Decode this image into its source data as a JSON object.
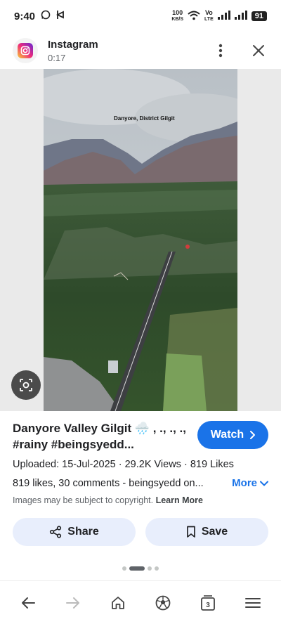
{
  "status_bar": {
    "time": "9:40",
    "net_speed_top": "100",
    "net_speed_bottom": "KB/S",
    "volte_top": "Vo",
    "volte_bottom": "LTE",
    "battery": "91"
  },
  "header": {
    "app_name": "Instagram",
    "duration": "0:17"
  },
  "image": {
    "overlay_caption": "Danyore, District Gilgit"
  },
  "result": {
    "title": "Danyore Valley Gilgit 🌧️ , ., ., ., #rainy #beingsyedd...",
    "watch_label": "Watch",
    "meta": "Uploaded: 15-Jul-2025 · 29.2K Views · 819 Likes",
    "description": "819 likes, 30 comments - beingsyedd on...",
    "more_label": "More",
    "copyright_text": "Images may be subject to copyright.",
    "learn_more": "Learn More"
  },
  "actions": {
    "share_label": "Share",
    "save_label": "Save"
  },
  "pagination": {
    "current": 2,
    "total": 4
  },
  "bottom_nav": {
    "tab_count": "3"
  },
  "colors": {
    "accent": "#1a73e8",
    "pill_bg": "#e8eefc"
  }
}
